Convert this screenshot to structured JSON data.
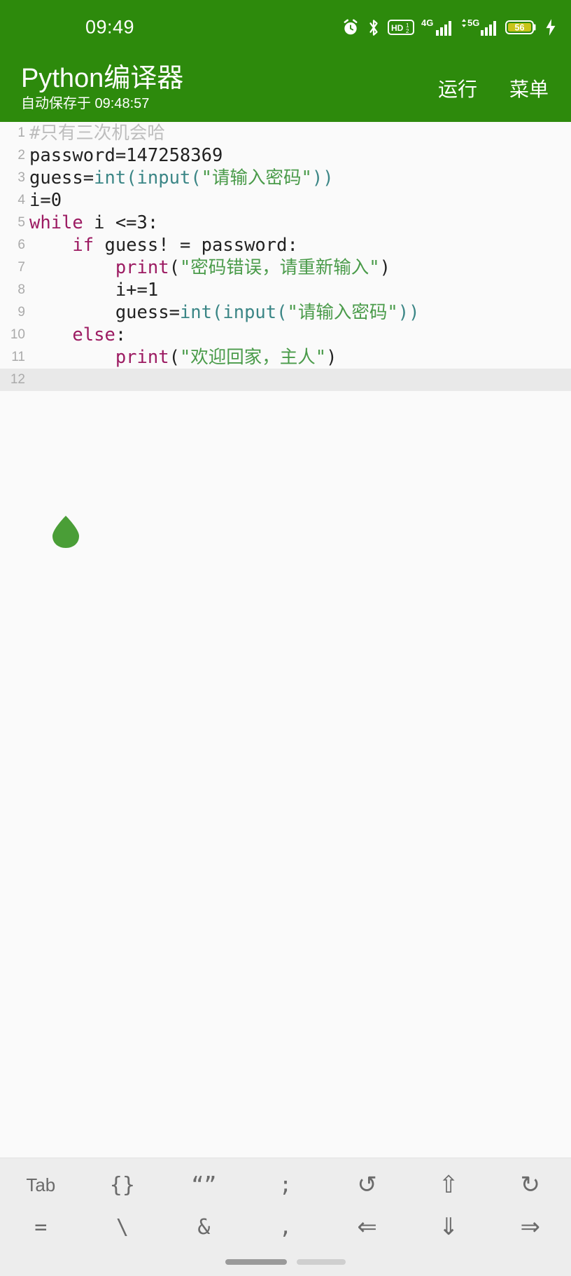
{
  "statusbar": {
    "clock": "09:49",
    "icons": [
      {
        "name": "alarm-icon",
        "label": "alarm"
      },
      {
        "name": "bluetooth-icon",
        "label": "bluetooth"
      },
      {
        "name": "volte-hd-icon",
        "label": "HD1/2"
      },
      {
        "name": "signal-4g-icon",
        "label": "4G"
      },
      {
        "name": "signal-5g-icon",
        "label": "5G"
      },
      {
        "name": "battery-icon",
        "label": "56"
      },
      {
        "name": "charging-bolt-icon",
        "label": "charging"
      }
    ],
    "battery_level": "56",
    "battery_color": "#c9c41a"
  },
  "appbar": {
    "title": "Python编译器",
    "subtitle": "自动保存于 09:48:57",
    "run_label": "运行",
    "menu_label": "菜单",
    "background": "#2d8a0c"
  },
  "editor": {
    "active_line": 12,
    "caret_handle_color": "#4a9e37",
    "lines": [
      {
        "num": "1",
        "tokens": [
          {
            "t": "#只有三次机会哈",
            "c": "tok-comment"
          }
        ]
      },
      {
        "num": "2",
        "tokens": [
          {
            "t": "password=147258369",
            "c": "tok-plain"
          }
        ]
      },
      {
        "num": "3",
        "tokens": [
          {
            "t": "guess=",
            "c": "tok-plain"
          },
          {
            "t": "int",
            "c": "tok-builtin"
          },
          {
            "t": "(",
            "c": "tok-builtin"
          },
          {
            "t": "input",
            "c": "tok-builtin"
          },
          {
            "t": "(",
            "c": "tok-builtin"
          },
          {
            "t": "\"请输入密码\"",
            "c": "tok-str"
          },
          {
            "t": ")",
            "c": "tok-builtin"
          },
          {
            "t": ")",
            "c": "tok-builtin"
          }
        ]
      },
      {
        "num": "4",
        "tokens": [
          {
            "t": "i=0",
            "c": "tok-plain"
          }
        ]
      },
      {
        "num": "5",
        "tokens": [
          {
            "t": "while",
            "c": "tok-kw"
          },
          {
            "t": " i <=3:",
            "c": "tok-plain"
          }
        ]
      },
      {
        "num": "6",
        "tokens": [
          {
            "t": "    ",
            "c": "tok-plain"
          },
          {
            "t": "if",
            "c": "tok-kw"
          },
          {
            "t": " guess! = password:",
            "c": "tok-plain"
          }
        ]
      },
      {
        "num": "7",
        "tokens": [
          {
            "t": "        ",
            "c": "tok-plain"
          },
          {
            "t": "print",
            "c": "tok-fn"
          },
          {
            "t": "(",
            "c": "tok-plain"
          },
          {
            "t": "\"密码错误，请重新输入\"",
            "c": "tok-str"
          },
          {
            "t": ")",
            "c": "tok-plain"
          }
        ]
      },
      {
        "num": "8",
        "tokens": [
          {
            "t": "        i+=1",
            "c": "tok-plain"
          }
        ]
      },
      {
        "num": "9",
        "tokens": [
          {
            "t": "        guess=",
            "c": "tok-plain"
          },
          {
            "t": "int",
            "c": "tok-builtin"
          },
          {
            "t": "(",
            "c": "tok-builtin"
          },
          {
            "t": "input",
            "c": "tok-builtin"
          },
          {
            "t": "(",
            "c": "tok-builtin"
          },
          {
            "t": "\"请输入密码\"",
            "c": "tok-str"
          },
          {
            "t": ")",
            "c": "tok-builtin"
          },
          {
            "t": ")",
            "c": "tok-builtin"
          }
        ]
      },
      {
        "num": "10",
        "tokens": [
          {
            "t": "    ",
            "c": "tok-plain"
          },
          {
            "t": "else",
            "c": "tok-kw"
          },
          {
            "t": ":",
            "c": "tok-plain"
          }
        ]
      },
      {
        "num": "11",
        "tokens": [
          {
            "t": "        ",
            "c": "tok-plain"
          },
          {
            "t": "print",
            "c": "tok-fn"
          },
          {
            "t": "(",
            "c": "tok-plain"
          },
          {
            "t": "\"欢迎回家，主人\"",
            "c": "tok-str"
          },
          {
            "t": ")",
            "c": "tok-plain"
          }
        ]
      },
      {
        "num": "12",
        "tokens": [
          {
            "t": "",
            "c": "tok-plain"
          }
        ]
      }
    ]
  },
  "toolbar": {
    "rows": [
      [
        {
          "name": "key-tab",
          "label": "Tab",
          "style": "small"
        },
        {
          "name": "key-braces",
          "label": "{}",
          "style": "mono"
        },
        {
          "name": "key-quotes",
          "label": "“”",
          "style": "mono"
        },
        {
          "name": "key-semicolon",
          "label": ";",
          "style": "mono"
        },
        {
          "name": "key-undo",
          "label": "↺",
          "style": "sym"
        },
        {
          "name": "key-arrow-up",
          "label": "⇧",
          "style": "sym"
        },
        {
          "name": "key-redo",
          "label": "↻",
          "style": "sym"
        }
      ],
      [
        {
          "name": "key-equals",
          "label": "=",
          "style": "mono"
        },
        {
          "name": "key-backslash",
          "label": "\\",
          "style": "mono"
        },
        {
          "name": "key-ampersand",
          "label": "&",
          "style": "mono"
        },
        {
          "name": "key-comma",
          "label": ",",
          "style": "mono"
        },
        {
          "name": "key-arrow-left",
          "label": "⇐",
          "style": "sym"
        },
        {
          "name": "key-arrow-down",
          "label": "⇓",
          "style": "sym"
        },
        {
          "name": "key-arrow-right",
          "label": "⇒",
          "style": "sym"
        }
      ]
    ]
  },
  "navbar": {
    "pills": [
      "dark",
      "light"
    ]
  }
}
